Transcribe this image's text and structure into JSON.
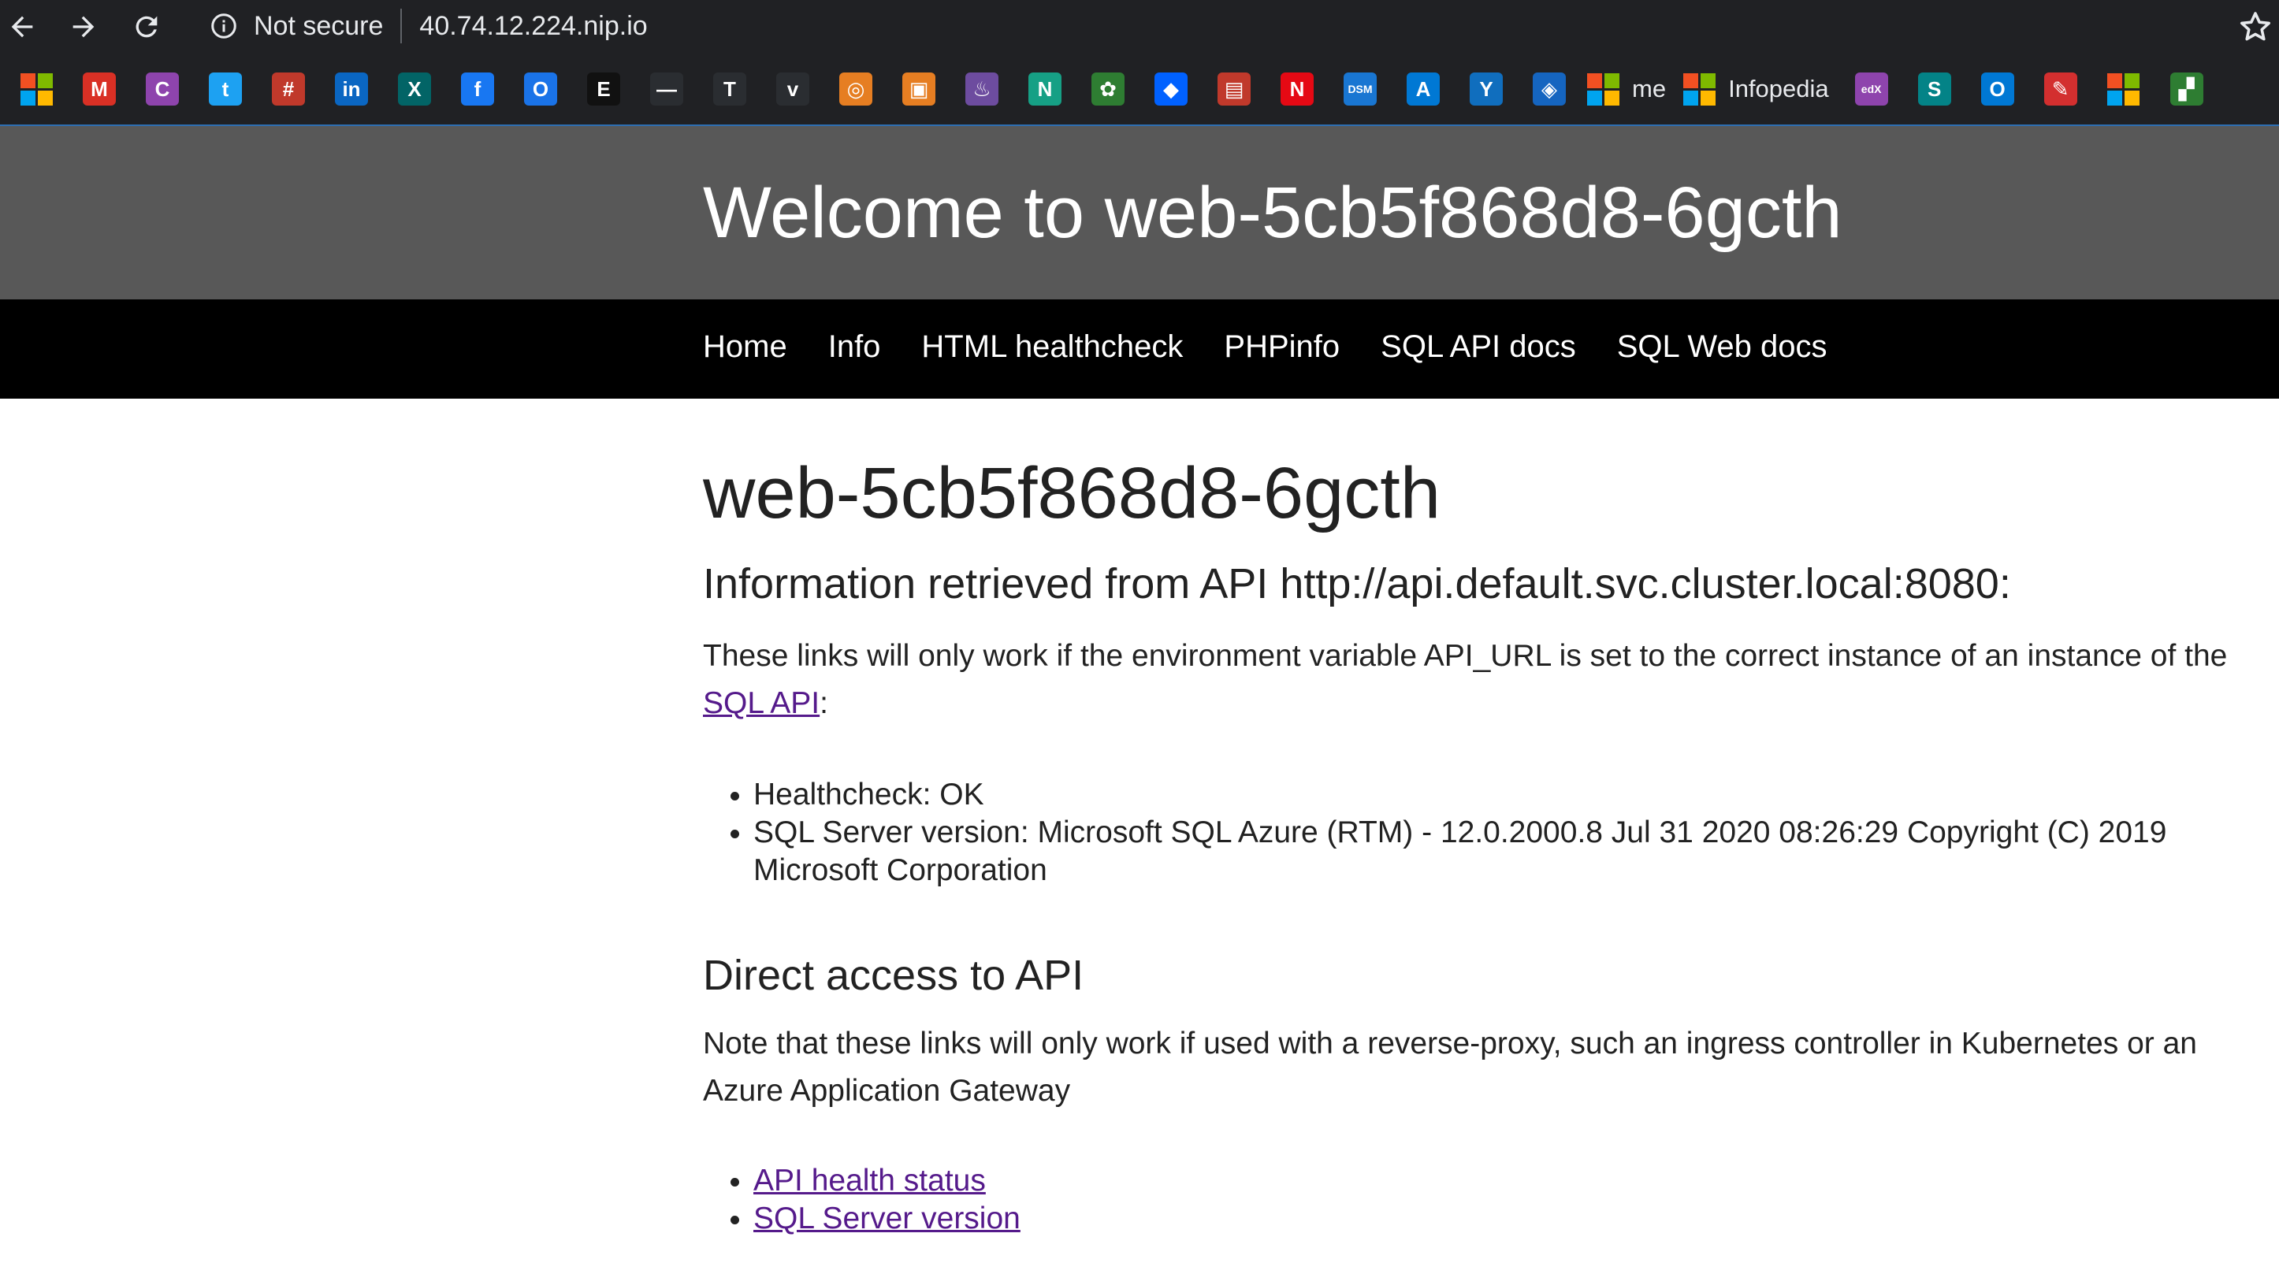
{
  "browser": {
    "security_label": "Not secure",
    "url": "40.74.12.224.nip.io",
    "bookmarks": [
      {
        "icon": "microsoft-icon",
        "type": "ms"
      },
      {
        "icon": "gmail-icon",
        "glyph": "M",
        "color": "#d93025"
      },
      {
        "icon": "purple-c-icon",
        "glyph": "C",
        "color": "#8e44ad"
      },
      {
        "icon": "twitter-icon",
        "glyph": "t",
        "color": "#1da1f2"
      },
      {
        "icon": "hashtag-icon",
        "glyph": "#",
        "color": "#c0392b"
      },
      {
        "icon": "linkedin-icon",
        "glyph": "in",
        "color": "#0a66c2"
      },
      {
        "icon": "xing-icon",
        "glyph": "X",
        "color": "#026466"
      },
      {
        "icon": "facebook-icon",
        "glyph": "f",
        "color": "#1877f2"
      },
      {
        "icon": "circle-o-icon",
        "glyph": "O",
        "color": "#1a73e8"
      },
      {
        "icon": "economist-e-icon",
        "glyph": "E",
        "color": "#111111"
      },
      {
        "icon": "dash-icon",
        "glyph": "—",
        "color": "#2a2d31"
      },
      {
        "icon": "nyt-icon",
        "glyph": "T",
        "color": "#2a2d31"
      },
      {
        "icon": "chevron-icon",
        "glyph": "v",
        "color": "#2a2d31"
      },
      {
        "icon": "circles-icon",
        "glyph": "◎",
        "color": "#e67e22"
      },
      {
        "icon": "orange-square-icon",
        "glyph": "▣",
        "color": "#e67e22"
      },
      {
        "icon": "flask-icon",
        "glyph": "♨",
        "color": "#6d4c9f"
      },
      {
        "icon": "n-icon",
        "glyph": "N",
        "color": "#16a085"
      },
      {
        "icon": "tree-icon",
        "glyph": "✿",
        "color": "#2e7d32"
      },
      {
        "icon": "dropbox-icon",
        "glyph": "◆",
        "color": "#0061ff"
      },
      {
        "icon": "briefcase-icon",
        "glyph": "▤",
        "color": "#c0392b"
      },
      {
        "icon": "netflix-icon",
        "glyph": "N",
        "color": "#e50914"
      },
      {
        "icon": "dsm-icon",
        "glyph": "DSM",
        "color": "#1976d2"
      },
      {
        "icon": "azure-icon",
        "glyph": "A",
        "color": "#0078d4"
      },
      {
        "icon": "yammer-icon",
        "glyph": "Y",
        "color": "#106ebe"
      },
      {
        "icon": "diamond-icon",
        "glyph": "◈",
        "color": "#1565c0"
      },
      {
        "icon": "microsoft-icon",
        "type": "ms",
        "label": "me"
      },
      {
        "icon": "microsoft-icon",
        "type": "ms",
        "label": "Infopedia"
      },
      {
        "icon": "edx-icon",
        "glyph": "edX",
        "color": "#8e44ad"
      },
      {
        "icon": "sharepoint-icon",
        "glyph": "S",
        "color": "#038387"
      },
      {
        "icon": "outlook-icon",
        "glyph": "O",
        "color": "#0078d4"
      },
      {
        "icon": "pen-icon",
        "glyph": "✎",
        "color": "#d32f2f"
      },
      {
        "icon": "microsoft-icon",
        "type": "ms"
      },
      {
        "icon": "green-flag-icon",
        "glyph": "▞",
        "color": "#2e7d32"
      }
    ]
  },
  "page": {
    "header_title": "Welcome to web-5cb5f868d8-6gcth",
    "nav": [
      "Home",
      "Info",
      "HTML healthcheck",
      "PHPinfo",
      "SQL API docs",
      "SQL Web docs"
    ],
    "hostname": "web-5cb5f868d8-6gcth",
    "api_heading": "Information retrieved from API http://api.default.svc.cluster.local:8080:",
    "api_note_prefix": "These links will only work if the environment variable API_URL is set to the correct instance of an instance of the",
    "api_note_link": "SQL API",
    "api_note_suffix": ":",
    "api_items": [
      "Healthcheck: OK",
      "SQL Server version: Microsoft SQL Azure (RTM) - 12.0.2000.8 Jul 31 2020 08:26:29 Copyright (C) 2019 Microsoft Corporation"
    ],
    "direct_heading": "Direct access to API",
    "direct_note": "Note that these links will only work if used with a reverse-proxy, such an ingress controller in Kubernetes or an Azure Application Gateway",
    "direct_links": [
      "API health status",
      "SQL Server version"
    ]
  }
}
